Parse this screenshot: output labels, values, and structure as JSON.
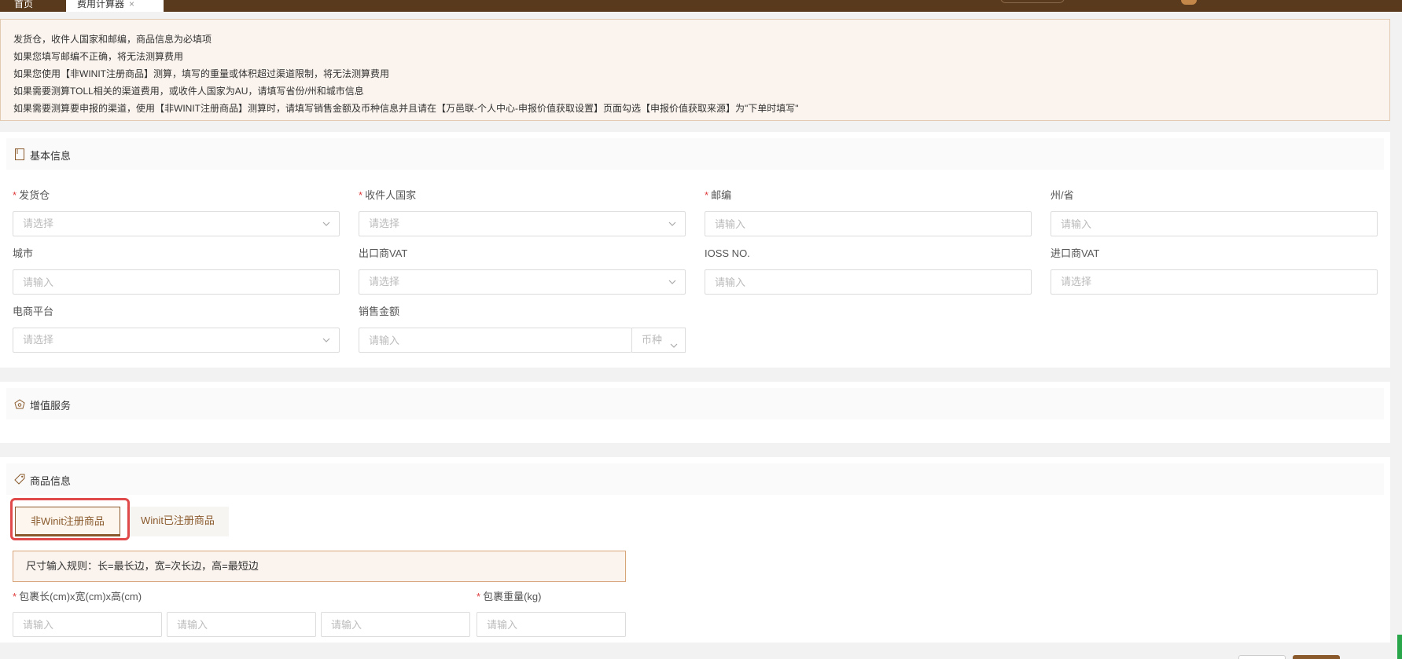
{
  "topbar": {
    "tabs": [
      {
        "label": "首页"
      },
      {
        "label": "费用计算器",
        "close": "×"
      }
    ]
  },
  "notice": {
    "lines": [
      "发货仓，收件人国家和邮编，商品信息为必填项",
      "如果您填写邮编不正确，将无法测算费用",
      "如果您使用【非WINIT注册商品】测算，填写的重量或体积超过渠道限制，将无法测算费用",
      "如果需要测算TOLL相关的渠道费用，或收件人国家为AU，请填写省份/州和城市信息",
      "如果需要测算要申报的渠道，使用【非WINIT注册商品】测算时，请填写销售金额及币种信息并且请在【万邑联-个人中心-申报价值获取设置】页面勾选【申报价值获取来源】为\"下单时填写\""
    ]
  },
  "basic_info": {
    "title": "基本信息",
    "icon": "document-icon",
    "fields": {
      "warehouse": {
        "label": "发货仓",
        "required": "*",
        "placeholder": "请选择"
      },
      "country": {
        "label": "收件人国家",
        "required": "*",
        "placeholder": "请选择"
      },
      "postcode": {
        "label": "邮编",
        "required": "*",
        "placeholder": "请输入"
      },
      "state": {
        "label": "州/省",
        "placeholder": "请输入"
      },
      "city": {
        "label": "城市",
        "placeholder": "请输入"
      },
      "export_vat": {
        "label": "出口商VAT",
        "placeholder": "请选择"
      },
      "ioss": {
        "label": "IOSS NO.",
        "placeholder": "请输入"
      },
      "import_vat": {
        "label": "进口商VAT",
        "placeholder": "请选择"
      },
      "platform": {
        "label": "电商平台",
        "placeholder": "请选择"
      },
      "sales_amount": {
        "label": "销售金额",
        "placeholder": "请输入",
        "currency": "币种"
      }
    }
  },
  "value_added": {
    "title": "增值服务",
    "icon": "service-icon"
  },
  "goods_info": {
    "title": "商品信息",
    "icon": "tag-icon",
    "tabs": {
      "non_registered": "非Winit注册商品",
      "registered": "Winit已注册商品"
    },
    "rule_note": "尺寸输入规则：长=最长边，宽=次长边，高=最短边",
    "dimensions": {
      "label": "包裹长(cm)x宽(cm)x高(cm)",
      "required": "*",
      "placeholder": "请输入"
    },
    "weight": {
      "label": "包裹重量(kg)",
      "required": "*",
      "placeholder": "请输入"
    }
  },
  "colors": {
    "brand": "#5a3a1c",
    "accent": "#8a5a2c",
    "required": "#e03c3c",
    "highlight": "#e04a4a"
  }
}
